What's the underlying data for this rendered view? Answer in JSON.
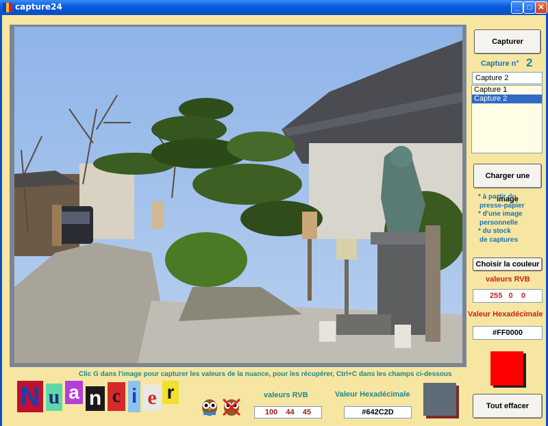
{
  "window": {
    "title": "capture24"
  },
  "titlebar_buttons": {
    "minimize": "_",
    "maximize": "□",
    "close": "✕"
  },
  "panel": {
    "capture_button": "Capturer",
    "capture_count_label": "Capture n°",
    "capture_count": "2",
    "capture_name_value": "Capture 2",
    "capture_list": [
      "Capture 1",
      "Capture 2"
    ],
    "load_button": "Charger une image",
    "load_hints": [
      "* à partir du",
      "presse-papier",
      "* d'une image",
      "personnelle",
      "* du stock",
      "de captures"
    ],
    "choose_color_button": "Choisir la couleur",
    "rgb_label": "valeurs RVB",
    "rgb_value": "255   0    0",
    "hex_label": "Valeur Hexadécimale",
    "hex_value": "#FF0000",
    "clear_button": "Tout effacer"
  },
  "bottom": {
    "instruction": "Clic G dans l'image pour capturer les valeurs de la nuance, pour les récupérer, Ctrl+C dans les champs ci-dessous",
    "logo_letters": [
      "N",
      "u",
      "a",
      "n",
      "c",
      "i",
      "e",
      "r"
    ],
    "rgb_label": "valeurs RVB",
    "rgb_value": "100    44    45",
    "hex_label": "Valeur Hexadécimale",
    "hex_value": "#642C2D"
  },
  "colors": {
    "chosen_swatch": "#ff0000",
    "captured_swatch": "#5d6b76",
    "accent_blue": "#1a72b8",
    "label_red": "#cc1e1e",
    "label_teal": "#1b8a8a"
  }
}
